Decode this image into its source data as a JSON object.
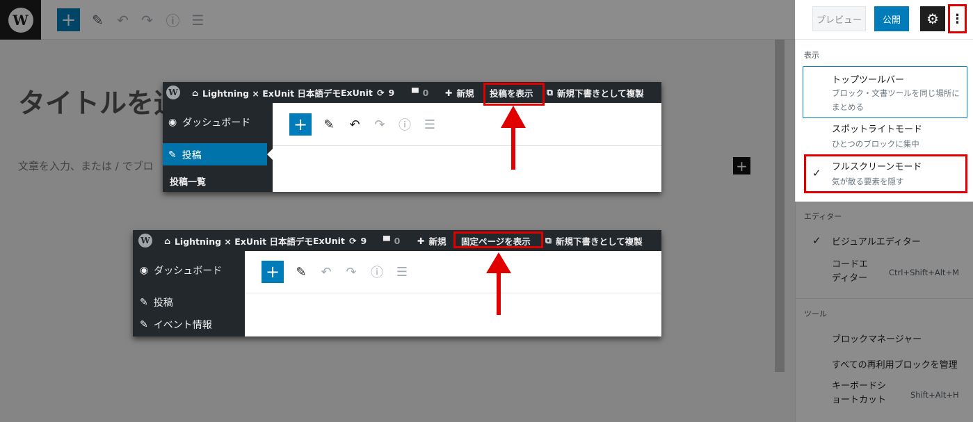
{
  "editor": {
    "title_placeholder": "タイトルを追",
    "body_placeholder": "文章を入力、または / でブロ"
  },
  "toolbar": {
    "add_icon": "plus-icon",
    "edit_icon": "pencil-icon",
    "undo_icon": "undo-icon",
    "redo_icon": "redo-icon",
    "info_icon": "info-icon",
    "outline_icon": "list-icon"
  },
  "header": {
    "preview_label": "プレビュー",
    "publish_label": "公開",
    "settings_icon": "gear-icon",
    "more_icon": "more-vertical-icon"
  },
  "menu": {
    "view_section": "表示",
    "top_toolbar": "トップツールバー",
    "top_toolbar_desc": "ブロック・文書ツールを同じ場所にまとめる",
    "spotlight": "スポットライトモード",
    "spotlight_desc": "ひとつのブロックに集中",
    "fullscreen": "フルスクリーンモード",
    "fullscreen_desc": "気が散る要素を隠す",
    "editor_section": "エディター",
    "visual_editor": "ビジュアルエディター",
    "code_editor": "コードエディター",
    "code_editor_shortcut": "Ctrl+Shift+Alt+M",
    "tools_section": "ツール",
    "block_manager": "ブロックマネージャー",
    "reusable_blocks": "すべての再利用ブロックを管理",
    "keyboard_shortcuts": "キーボードショートカット",
    "keyboard_shortcuts_shortcut": "Shift+Alt+H",
    "check_mark": "✓"
  },
  "shot1": {
    "site_name": "Lightning × ExUnit 日本語デモ",
    "exunit": "ExUnit",
    "updates_count": "9",
    "comments_count": "0",
    "new_label": "新規",
    "view_link": "投稿を表示",
    "duplicate_label": "新規下書きとして複製",
    "side_dashboard": "ダッシュボード",
    "side_posts": "投稿",
    "side_posts_list": "投稿一覧"
  },
  "shot2": {
    "site_name": "Lightning × ExUnit 日本語デモ",
    "exunit": "ExUnit",
    "updates_count": "9",
    "comments_count": "0",
    "new_label": "新規",
    "view_link": "固定ページを表示",
    "duplicate_label": "新規下書きとして複製",
    "side_dashboard": "ダッシュボード",
    "side_posts": "投稿",
    "side_events": "イベント情報"
  },
  "colors": {
    "accent": "#007cba",
    "admin_bar": "#23282d",
    "highlight_red": "#e00000",
    "sidebar_active": "#0073aa"
  }
}
